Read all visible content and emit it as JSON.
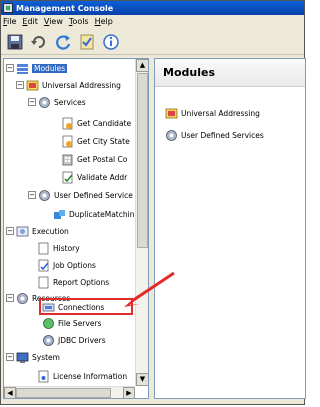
{
  "window": {
    "title": "Management Console"
  },
  "menu": [
    "File",
    "Edit",
    "View",
    "Tools",
    "Help"
  ],
  "toolbar": {
    "buttons": [
      "save-icon",
      "undo-icon",
      "refresh-icon",
      "checklist-icon",
      "info-icon"
    ]
  },
  "tree": {
    "modules": "Modules",
    "universal_addressing": "Universal Addressing",
    "services": "Services",
    "get_candidate": "Get Candidate",
    "get_city_state": "Get City State",
    "get_postal_code": "Get Postal Co",
    "validate_address": "Validate Addr",
    "user_defined_services": "User Defined Service",
    "duplicate_matching": "DuplicateMatchin",
    "execution": "Execution",
    "history": "History",
    "job_options": "Job Options",
    "report_options": "Report Options",
    "resources": "Resources",
    "connections": "Connections",
    "file_servers": "File Servers",
    "jdbc_drivers": "JDBC Drivers",
    "system": "System",
    "license_information": "License Information"
  },
  "content": {
    "heading": "Modules",
    "items": [
      "Universal Addressing",
      "User Defined Services"
    ]
  },
  "colors": {
    "annotation": "#e32b2b",
    "selection": "#316ac5",
    "titlebar": "#0a5fd8"
  }
}
